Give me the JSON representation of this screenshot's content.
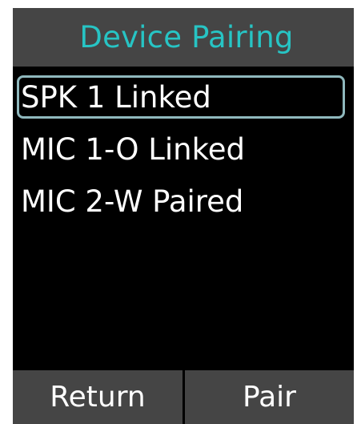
{
  "screen": {
    "title": "Device Pairing"
  },
  "devices": [
    {
      "label": "SPK 1 Linked",
      "selected": true
    },
    {
      "label": "MIC 1-O Linked",
      "selected": false
    },
    {
      "label": "MIC 2-W Paired",
      "selected": false
    }
  ],
  "softkeys": {
    "left_label": "Return",
    "right_label": "Pair"
  },
  "colors": {
    "title_text": "#27c4c4",
    "bar_background": "#454545",
    "screen_background": "#000000",
    "selection_border": "#8fb8bd",
    "item_text": "#ffffff"
  }
}
